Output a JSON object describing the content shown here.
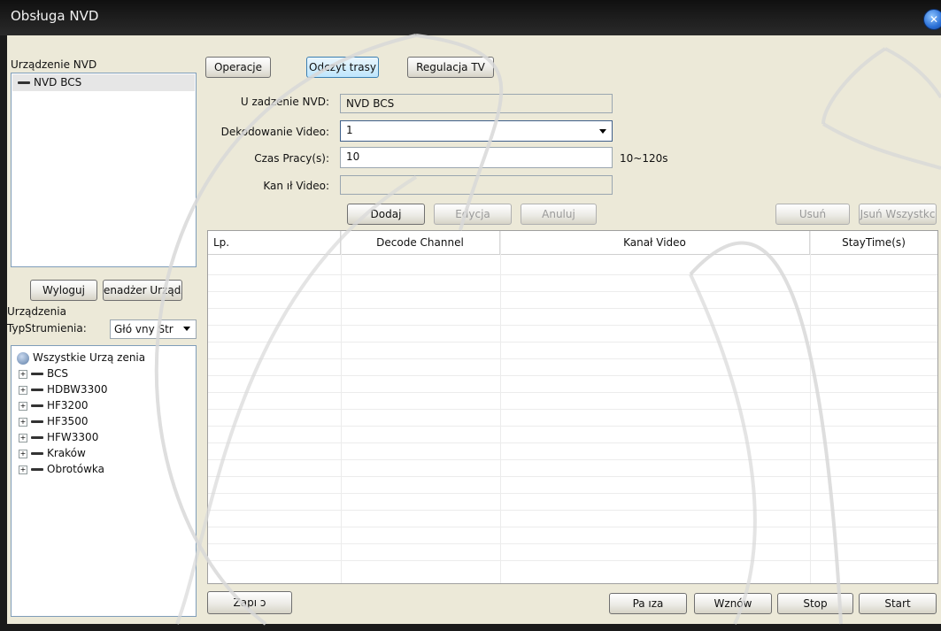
{
  "window": {
    "title": "Obsługa NVD",
    "close_icon": "close-icon"
  },
  "nvd_panel": {
    "label": "Urządzenie NVD",
    "items": [
      {
        "label": "NVD BCS",
        "icon": "device-icon"
      }
    ],
    "logout_button": "Wyloguj",
    "manager_button": "enadżer Urządze"
  },
  "devices_panel": {
    "label": "Urządzenia",
    "stream_type_label": "TypStrumienia:",
    "stream_type_value": "Głó vny Str",
    "root": "Wszystkie Urzą zenia",
    "items": [
      {
        "label": "BCS"
      },
      {
        "label": "HDBW3300"
      },
      {
        "label": "HF3200"
      },
      {
        "label": "HF3500"
      },
      {
        "label": "HFW3300"
      },
      {
        "label": "Kraków"
      },
      {
        "label": "Obrotówka"
      }
    ]
  },
  "tabs": [
    {
      "label": "Operacje"
    },
    {
      "label": "Odczyt trasy",
      "active": true
    },
    {
      "label": "Regulacja TV"
    }
  ],
  "form": {
    "device_label": "U zadzenie NVD:",
    "device_value": "NVD BCS",
    "decode_label": "Dekodowanie Video:",
    "decode_value": "1",
    "work_time_label": "Czas Pracy(s):",
    "work_time_value": "10",
    "work_time_hint": "10~120s",
    "video_channel_label": "Kan ıł Video:",
    "video_channel_value": ""
  },
  "actions": {
    "add": "Dodaj",
    "edit": "Edycja",
    "cancel": "Anuluj",
    "delete": "Usuń",
    "delete_all": "Jsuń Wszystkc"
  },
  "table": {
    "columns": [
      "Lp.",
      "Decode Channel",
      "Kanał Video",
      "StayTime(s)"
    ],
    "rows": []
  },
  "footer": {
    "save": "Zapı ɔ",
    "pause": "Pa ıza",
    "resume": "Wznów",
    "stop": "Stop",
    "start": "Start"
  }
}
